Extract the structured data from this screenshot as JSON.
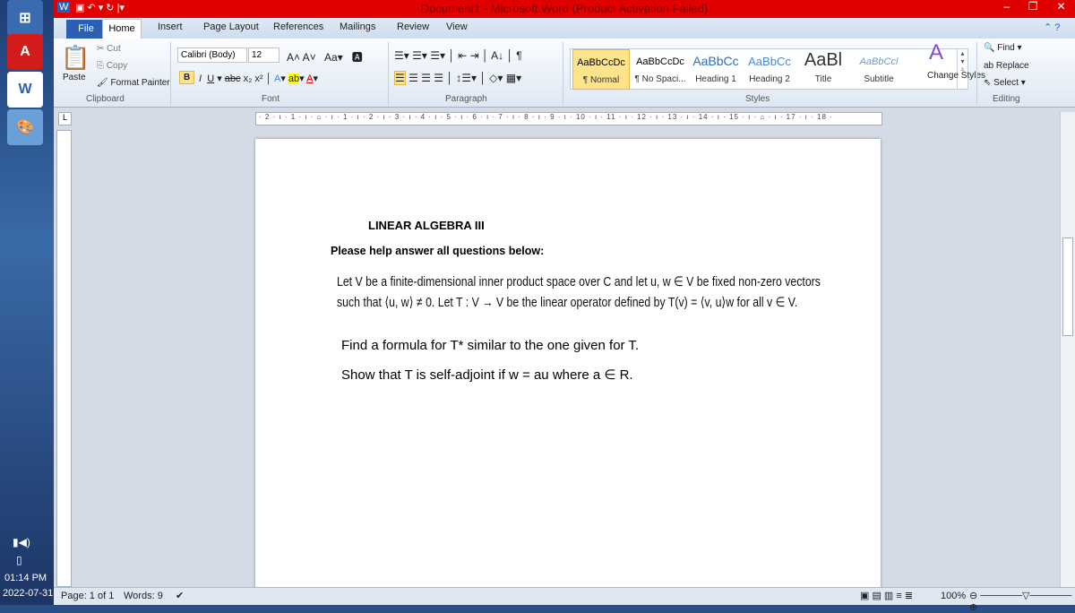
{
  "window": {
    "title": "Document1 - Microsoft Word (Product Activation Failed)"
  },
  "tabs": [
    "File",
    "Home",
    "Insert",
    "Page Layout",
    "References",
    "Mailings",
    "Review",
    "View"
  ],
  "clipboard": {
    "paste": "Paste",
    "cut": "Cut",
    "copy": "Copy",
    "format_painter": "Format Painter",
    "label": "Clipboard"
  },
  "font": {
    "name": "Calibri (Body)",
    "size": "12",
    "label": "Font"
  },
  "paragraph": {
    "label": "Paragraph"
  },
  "styles": {
    "items": [
      {
        "preview": "AaBbCcDc",
        "name": "¶ Normal"
      },
      {
        "preview": "AaBbCcDc",
        "name": "¶ No Spaci..."
      },
      {
        "preview": "AaBbCc",
        "name": "Heading 1"
      },
      {
        "preview": "AaBbCc",
        "name": "Heading 2"
      },
      {
        "preview": "AaBl",
        "name": "Title"
      },
      {
        "preview": "AaBbCcl",
        "name": "Subtitle"
      }
    ],
    "change_styles": "Change Styles",
    "label": "Styles"
  },
  "editing": {
    "find": "Find",
    "replace": "Replace",
    "select": "Select",
    "label": "Editing"
  },
  "ruler": "· 2 · ı · 1 · ı · ⌂ · ı · 1 · ı · 2 · ı · 3 · ı · 4 · ı · 5 · ı · 6 · ı · 7 · ı · 8 · ı · 9 · ı · 10 · ı · 11 · ı · 12 · ı · 13 · ı · 14 · ı · 15 · ı · ⌂ · ı · 17 · ı · 18 ·",
  "document": {
    "heading": "LINEAR ALGEBRA III",
    "instruction": "Please help answer all questions below:",
    "problem_line1": "Let V be a finite-dimensional inner product space over C and let u, w ∈ V be fixed non-zero vectors",
    "problem_line2": "such that ⟨u, w⟩ ≠ 0. Let T : V → V be the linear operator defined by T(v) = ⟨v, u⟩w for all v ∈ V.",
    "q1": "Find a formula for T* similar to the one given for T.",
    "q2": "Show that T is self-adjoint if w = au where a ∈ R."
  },
  "status": {
    "page": "Page: 1 of 1",
    "words": "Words: 9",
    "zoom": "100%"
  },
  "taskbar": {
    "time": "01:14 PM",
    "date": "2022-07-31"
  },
  "colors": {
    "titlebar": "#e00000",
    "file_tab": "#2b5fb4"
  }
}
